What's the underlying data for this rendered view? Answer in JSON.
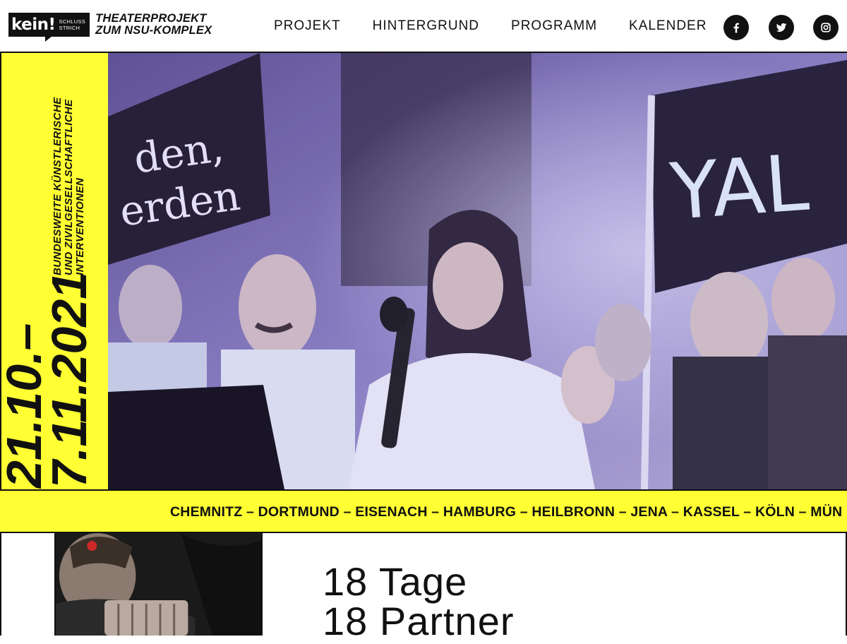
{
  "logo": {
    "kein": "kein!",
    "schluss": "SCHLUSS",
    "strich": "STRICH",
    "title_line1": "THEATERPROJEKT",
    "title_line2": "ZUM NSU-KOMPLEX"
  },
  "nav": {
    "items": [
      {
        "label": "PROJEKT"
      },
      {
        "label": "HINTERGRUND"
      },
      {
        "label": "PROGRAMM"
      },
      {
        "label": "KALENDER"
      }
    ]
  },
  "social": [
    {
      "icon": "facebook-icon"
    },
    {
      "icon": "twitter-icon"
    },
    {
      "icon": "instagram-icon"
    }
  ],
  "side_panel": {
    "dates_line1": "21.10.–",
    "dates_line2": "7.11.2021",
    "text_line1": "BUNDESWEITE KÜNSTLERISCHE",
    "text_line2": "UND ZIVILGESELLSCHAFTLICHE",
    "text_line3": "INTERVENTIONEN"
  },
  "hero": {
    "banner_left_line1": "den,",
    "banner_left_line2": "erden",
    "banner_right": "YAL"
  },
  "ticker": {
    "cities": "CHEMNITZ – DORTMUND – EISENACH – HAMBURG – HEILBRONN – JENA – KASSEL – KÖLN – MÜN"
  },
  "intro": {
    "line1": "18 Tage",
    "line2": "18 Partner"
  },
  "colors": {
    "accent_yellow": "#ffff33",
    "ink": "#111111"
  }
}
